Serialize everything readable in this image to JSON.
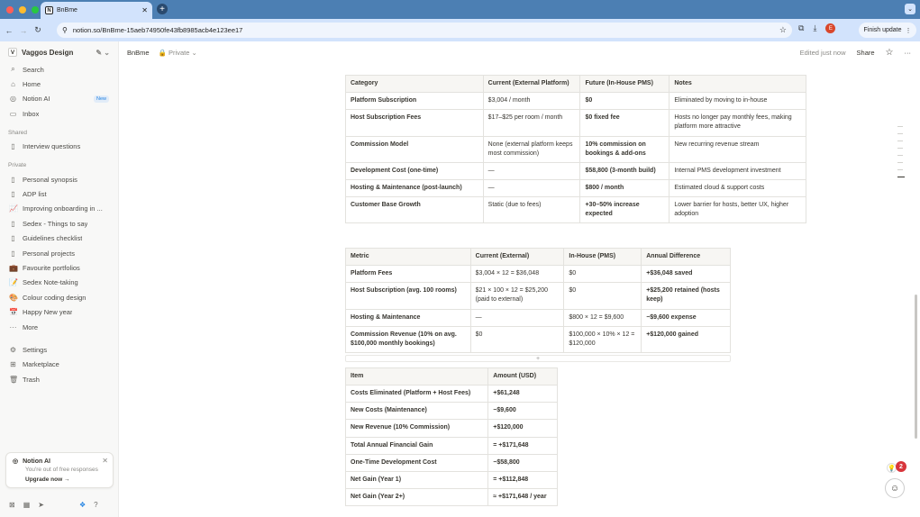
{
  "browser": {
    "tab_title": "BnBme",
    "tab_favicon": "N",
    "url": "notion.so/BnBme-15aeb74950fe43fb8985acb4e123ee17",
    "profile_initial": "E",
    "finish_update": "Finish update",
    "colors": {
      "frame": "#4c7fb3",
      "toolbar": "#d2e3fc",
      "close": "#ff5f57",
      "min": "#febc2e",
      "max": "#28c840"
    }
  },
  "sidebar": {
    "workspace_initial": "V",
    "workspace": "Vaggos Design",
    "nav": [
      {
        "icon": "search-icon",
        "glyph": "⌕",
        "label": "Search"
      },
      {
        "icon": "home-icon",
        "glyph": "⌂",
        "label": "Home"
      },
      {
        "icon": "notion-ai-icon",
        "glyph": "◎",
        "label": "Notion AI",
        "badge": "New"
      },
      {
        "icon": "inbox-icon",
        "glyph": "▭",
        "label": "Inbox"
      }
    ],
    "shared_label": "Shared",
    "shared": [
      {
        "icon": "page-icon",
        "glyph": "▯",
        "label": "Interview questions"
      }
    ],
    "private_label": "Private",
    "private": [
      {
        "icon": "page-icon",
        "glyph": "▯",
        "label": "Personal synopsis"
      },
      {
        "icon": "page-icon",
        "glyph": "▯",
        "label": "ADP list"
      },
      {
        "icon": "chart-icon",
        "glyph": "📈",
        "label": "Improving onboarding in ..."
      },
      {
        "icon": "page-icon",
        "glyph": "▯",
        "label": "Sedex - Things to say"
      },
      {
        "icon": "page-icon",
        "glyph": "▯",
        "label": "Guidelines checklist"
      },
      {
        "icon": "page-icon",
        "glyph": "▯",
        "label": "Personal projects"
      },
      {
        "icon": "briefcase-icon",
        "glyph": "💼",
        "label": "Favourite portfolios"
      },
      {
        "icon": "notepad-icon",
        "glyph": "📝",
        "label": "Sedex Note-taking"
      },
      {
        "icon": "palette-icon",
        "glyph": "🎨",
        "label": "Colour coding design"
      },
      {
        "icon": "calendar-icon",
        "glyph": "📅",
        "label": "Happy New year"
      },
      {
        "icon": "more-icon",
        "glyph": "···",
        "label": "More"
      }
    ],
    "bottom": [
      {
        "icon": "settings-icon",
        "glyph": "⚙",
        "label": "Settings"
      },
      {
        "icon": "marketplace-icon",
        "glyph": "⊞",
        "label": "Marketplace"
      },
      {
        "icon": "trash-icon",
        "glyph": "🗑",
        "label": "Trash"
      }
    ],
    "ai_card": {
      "title": "Notion AI",
      "subtitle": "You're out of free responses",
      "cta": "Upgrade now"
    }
  },
  "topbar": {
    "breadcrumb": "BnBme",
    "privacy": "Private",
    "edited": "Edited just now",
    "share": "Share"
  },
  "table1": {
    "headers": [
      "Category",
      "Current (External Platform)",
      "Future (In-House PMS)",
      "Notes"
    ],
    "rows": [
      [
        "Platform Subscription",
        "$3,004 / month",
        "$0",
        "Eliminated by moving to in-house"
      ],
      [
        "Host Subscription Fees",
        "$17–$25 per room / month",
        "$0 fixed fee",
        "Hosts no longer pay monthly fees, making platform more attractive"
      ],
      [
        "Commission Model",
        "None (external platform keeps most commission)",
        "10% commission on bookings & add-ons",
        "New recurring revenue stream"
      ],
      [
        "Development Cost (one-time)",
        "—",
        "$58,800 (3-month build)",
        "Internal PMS development investment"
      ],
      [
        "Hosting & Maintenance (post-launch)",
        "—",
        "$800 / month",
        "Estimated cloud & support costs"
      ],
      [
        "Customer Base Growth",
        "Static (due to fees)",
        "+30–50% increase expected",
        "Lower barrier for hosts, better UX, higher adoption"
      ]
    ]
  },
  "table2": {
    "headers": [
      "Metric",
      "Current (External)",
      "In-House (PMS)",
      "Annual Difference"
    ],
    "rows": [
      [
        "Platform Fees",
        "$3,004 × 12 = $36,048",
        "$0",
        "+$36,048 saved"
      ],
      [
        "Host Subscription (avg. 100 rooms)",
        "$21 × 100 × 12 = $25,200 (paid to external)",
        "$0",
        "+$25,200 retained (hosts keep)"
      ],
      [
        "Hosting & Maintenance",
        "—",
        "$800 × 12 = $9,600",
        "−$9,600 expense"
      ],
      [
        "Commission Revenue (10% on avg. $100,000 monthly bookings)",
        "$0",
        "$100,000 × 10% × 12 = $120,000",
        "+$120,000 gained"
      ]
    ],
    "add_row": "+"
  },
  "table3": {
    "headers": [
      "Item",
      "Amount (USD)"
    ],
    "rows": [
      [
        "Costs Eliminated (Platform + Host Fees)",
        "+$61,248"
      ],
      [
        "New Costs (Maintenance)",
        "−$9,600"
      ],
      [
        "New Revenue (10% Commission)",
        "+$120,000"
      ],
      [
        "Total Annual Financial Gain",
        "= +$171,648"
      ],
      [
        "One-Time Development Cost",
        "−$58,800"
      ],
      [
        "Net Gain (Year 1)",
        "= +$112,848"
      ],
      [
        "Net Gain (Year 2+)",
        "≈ +$171,648 / year"
      ]
    ]
  },
  "help": {
    "badge_count": "2"
  }
}
